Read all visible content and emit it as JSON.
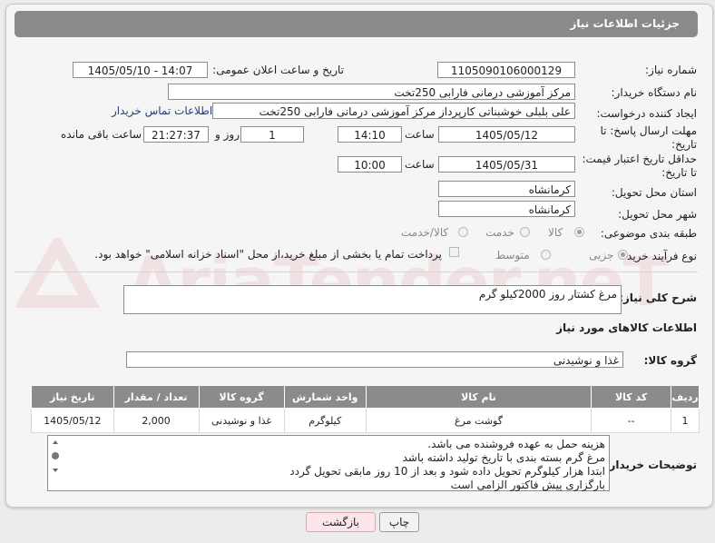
{
  "header": {
    "title": "جزئیات اطلاعات نیاز"
  },
  "watermark": {
    "text": "AriaTender.neT"
  },
  "fields": {
    "need_number_label": "شماره نیاز:",
    "need_number": "1105090106000129",
    "announce_label": "تاریخ و ساعت اعلان عمومی:",
    "announce_value": "1405/05/10 - 14:07",
    "buyer_org_label": "نام دستگاه خریدار:",
    "buyer_org": "مرکز آموزشی  درمانی فارابی 250تخت",
    "creator_label": "ایجاد کننده درخواست:",
    "creator": "علی بلبلی خوشبناتی کارپرداز مرکز آموزشی  درمانی فارابی 250تخت",
    "contact_link": "اطلاعات تماس خریدار",
    "deadline_label_1": "مهلت ارسال پاسخ: تا",
    "deadline_label_2": "تاریخ:",
    "deadline_date": "1405/05/12",
    "time_label": "ساعت",
    "deadline_time": "14:10",
    "days_value": "1",
    "days_label": "روز و",
    "remaining_value": "21:27:37",
    "remaining_label": "ساعت باقی مانده",
    "validity_label_1": "حداقل تاریخ اعتبار قیمت:",
    "validity_label_2": "تا تاریخ:",
    "validity_date": "1405/05/31",
    "validity_time": "10:00",
    "province_label": "استان محل تحویل:",
    "province": "کرمانشاه",
    "city_label": "شهر محل تحویل:",
    "city": "کرمانشاه",
    "category_label": "طبقه بندی موضوعی:",
    "category_options": [
      "کالا",
      "خدمت",
      "کالا/خدمت"
    ],
    "process_label": "نوع فرآیند خرید :",
    "process_options": [
      "جزیی",
      "متوسط"
    ],
    "payment_note": "پرداخت تمام یا بخشی از مبلغ خرید،از محل \"اسناد خزانه اسلامی\" خواهد بود."
  },
  "summary": {
    "label": "شرح کلی نیاز:",
    "text": "مرغ کشتار روز 2000کیلو گرم"
  },
  "goods": {
    "section_title": "اطلاعات کالاهای مورد نیاز",
    "group_label": "گروه کالا:",
    "group_value": "غذا و نوشیدنی"
  },
  "table": {
    "headers": [
      "ردیف",
      "کد کالا",
      "نام کالا",
      "واحد شمارش",
      "گروه کالا",
      "تعداد / مقدار",
      "تاریخ نیاز"
    ],
    "rows": [
      [
        "1",
        "--",
        "گوشت مرغ",
        "کیلوگرم",
        "غذا و نوشیدنی",
        "2,000",
        "1405/05/12"
      ]
    ]
  },
  "buyer_notes": {
    "label": "توضیحات خریدار:",
    "lines": [
      "هزینه حمل به عهده فروشنده می باشد.",
      "مرغ گرم بسته بندی با تاریخ تولید داشته باشد",
      "ابتدا هزار کیلوگرم تحویل داده شود و بعد از 10 روز مابقی تحویل گردد",
      "بارگزاری پیش فاکتور الزامی است"
    ]
  },
  "buttons": {
    "print": "چاپ",
    "back": "بازگشت"
  }
}
